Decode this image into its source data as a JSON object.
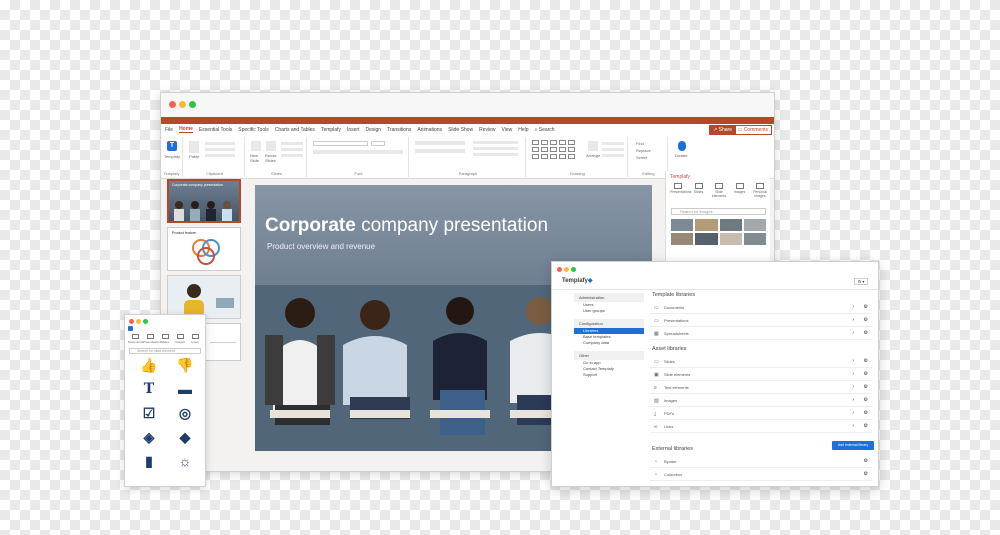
{
  "ppt": {
    "tabs": [
      "File",
      "Home",
      "Essential Tools",
      "Specific Tools",
      "Charts and Tables",
      "Templafy",
      "Insert",
      "Design",
      "Transitions",
      "Animations",
      "Slide Show",
      "Review",
      "View",
      "Help",
      "Search"
    ],
    "share_label": "Share",
    "comments_label": "Comments",
    "ribbon": {
      "templafy_label": "Templafy",
      "groups": [
        "Templafy",
        "Clipboard",
        "Slides",
        "Font",
        "Paragraph",
        "Drawing",
        "Editing",
        "Voice"
      ],
      "paste_label": "Paste",
      "new_slide_label": "New Slide",
      "reuse_slides_label": "Reuse Slides",
      "arrange_label": "Arrange",
      "find_label": "Find",
      "replace_label": "Replace",
      "select_label": "Select",
      "dictate_label": "Dictate"
    },
    "slide": {
      "title_bold": "Corporate",
      "title_rest": " company presentation",
      "subtitle": "Product overview and revenue"
    },
    "thumb_strip": {
      "thumb1_title": "Corporate company presentation",
      "thumb2_title": "Product feature"
    },
    "right_pane": {
      "title": "Templafy",
      "icons": [
        "Presentations",
        "Slides",
        "Slide elements",
        "Images",
        "Personal images"
      ],
      "search_placeholder": "Search for images"
    }
  },
  "mini_panel": {
    "icons": [
      "Documents",
      "Presentations",
      "Slides",
      "Images",
      "Icons"
    ],
    "search_placeholder": "Search for slide element"
  },
  "admin": {
    "logo": "Templafy",
    "menu_button": "⚙ ▾",
    "sidebar": [
      {
        "section": "Administration",
        "items": [
          "Users",
          "User groups"
        ]
      },
      {
        "section": "Configuration",
        "items": [
          "Libraries",
          "Base templates",
          "Company data"
        ]
      },
      {
        "section": "Other",
        "items": [
          "Go to app",
          "Contact Templafy",
          "Support"
        ]
      }
    ],
    "active_item": "Libraries",
    "template_libraries_heading": "Template libraries",
    "template_libraries": [
      "Documents",
      "Presentations",
      "Spreadsheets"
    ],
    "asset_libraries_heading": "Asset libraries",
    "asset_libraries": [
      "Slides",
      "Slide elements",
      "Text elements",
      "Images",
      "PDFs",
      "Links"
    ],
    "add_button": "Add external library",
    "external_libraries_heading": "External libraries",
    "external_libraries": [
      "Bynder",
      "Colourbox"
    ]
  }
}
